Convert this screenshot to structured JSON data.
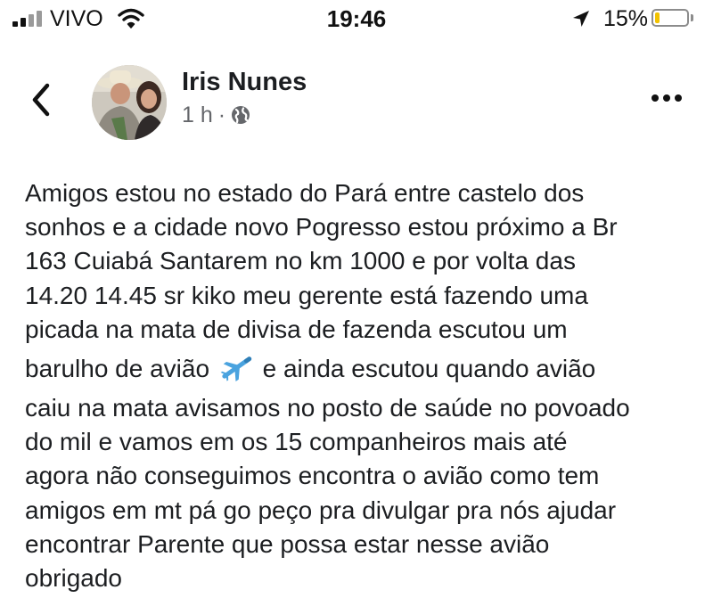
{
  "status_bar": {
    "carrier": "VIVO",
    "time": "19:46",
    "battery_percent_text": "15%",
    "battery_level": 0.15,
    "icons": [
      "signal-icon",
      "wifi-icon",
      "location-arrow-icon",
      "battery-icon"
    ]
  },
  "header": {
    "back_icon": "chevron-left-icon",
    "author_name": "Iris Nunes",
    "time": "1 h",
    "separator": "·",
    "privacy_icon": "globe-icon",
    "more_icon": "more-dots-icon"
  },
  "post": {
    "lines": [
      "Amigos estou no estado do Pará entre castelo dos",
      "sonhos e a cidade novo Pogresso estou próximo a Br",
      "163 Cuiabá Santarem no km 1000 e por volta das",
      "14.20 14.45 sr kiko meu gerente está fazendo uma",
      "picada na mata de divisa de fazenda escutou um",
      "caiu na mata avisamos no posto de saúde no povoado",
      "do mil e vamos em os 15 companheiros mais até",
      "agora não conseguimos encontra  o avião como tem",
      "amigos em mt pá go peço pra divulgar pra nós ajudar",
      "encontrar Parente que possa estar nesse avião",
      "obrigado"
    ],
    "emoji_line_before": "barulho de avião",
    "emoji_line_after": "e ainda escutou quando avião",
    "emoji_icon": "airplane-icon"
  },
  "colors": {
    "text": "#1c1e21",
    "meta": "#65676b",
    "battery_low": "#f2c200",
    "plane_blue": "#4aa3df"
  }
}
